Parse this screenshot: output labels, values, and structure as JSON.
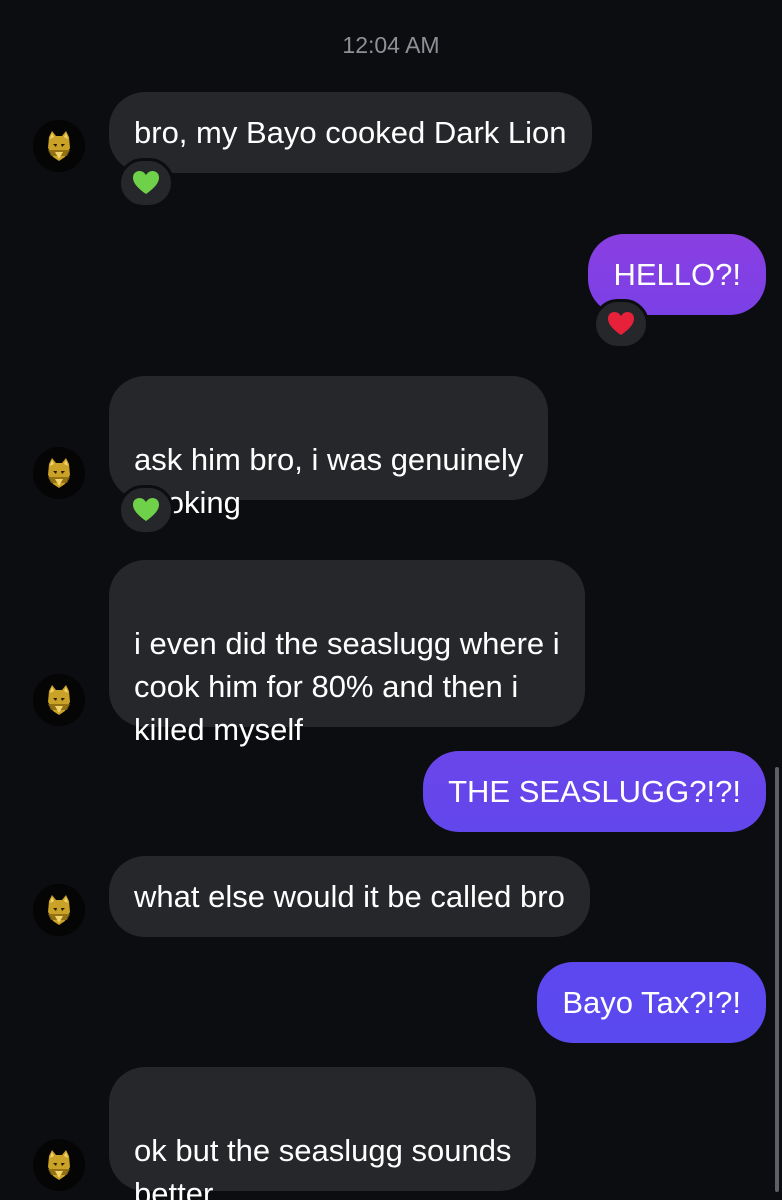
{
  "conversation": {
    "timestamp": "12:04 AM",
    "messages": [
      {
        "from": "them",
        "text": "bro, my Bayo cooked Dark Lion",
        "reaction": "green-heart"
      },
      {
        "from": "me",
        "text": "HELLO?!",
        "reaction": "red-heart"
      },
      {
        "from": "them",
        "text": "ask him bro, i was genuinely\ncooking",
        "reaction": "green-heart"
      },
      {
        "from": "them",
        "text": "i even did the seaslugg where i\ncook him for 80% and then i\nkilled myself"
      },
      {
        "from": "me",
        "text": "THE SEASLUGG?!?!"
      },
      {
        "from": "them",
        "text": "what else would it be called bro"
      },
      {
        "from": "me",
        "text": "Bayo Tax?!?!"
      },
      {
        "from": "them",
        "text": "ok but the seaslugg sounds\nbetter"
      }
    ]
  },
  "colors": {
    "background": "#0c0d11",
    "incoming_bubble": "#26272b",
    "outgoing_gradient_top": "#8b3fe0",
    "outgoing_gradient_bottom": "#5a48ee",
    "green_heart": "#6fd14a",
    "red_heart": "#e8213a"
  }
}
